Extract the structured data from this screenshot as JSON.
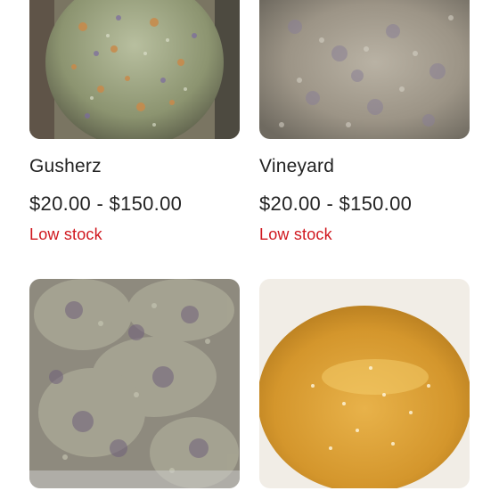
{
  "colors": {
    "stock": "#d0181f",
    "text": "#222222"
  },
  "products": [
    {
      "name": "Gusherz",
      "price": "$20.00 - $150.00",
      "stock": "Low stock",
      "image": "flower-bud-photo"
    },
    {
      "name": "Vineyard",
      "price": "$20.00 - $150.00",
      "stock": "Low stock",
      "image": "flower-bud-photo"
    },
    {
      "name": "",
      "price": "",
      "stock": "",
      "image": "flower-buds-photo"
    },
    {
      "name": "",
      "price": "",
      "stock": "",
      "image": "concentrate-photo"
    }
  ]
}
